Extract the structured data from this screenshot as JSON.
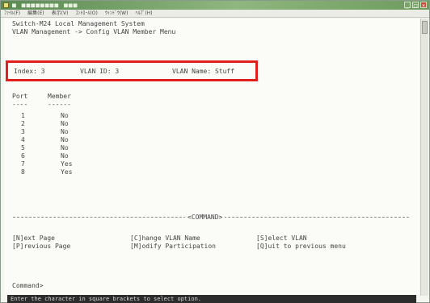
{
  "window": {
    "title": "■ ■■■■■■■■ ■■■"
  },
  "menubar": [
    "ﾌｧｲﾙ(F)",
    "編集(E)",
    "表示(V)",
    "ｺﾝﾄﾛｰﾙ(O)",
    "ｳｨﾝﾄﾞｳ(W)",
    "ﾍﾙﾌﾟ(H)"
  ],
  "terminal": {
    "system_title": "Switch-M24 Local Management System",
    "breadcrumb": "VLAN Management -> Config VLAN Member Menu",
    "index_label": "Index: 3",
    "vlan_id_label": "VLAN ID: 3",
    "vlan_name_label": "VLAN Name: Stuff",
    "columns": [
      "Port",
      "Member"
    ],
    "column_rules": [
      "----",
      "------"
    ],
    "rows": [
      {
        "port": "1",
        "member": "No"
      },
      {
        "port": "2",
        "member": "No"
      },
      {
        "port": "3",
        "member": "No"
      },
      {
        "port": "4",
        "member": "No"
      },
      {
        "port": "5",
        "member": "No"
      },
      {
        "port": "6",
        "member": "No"
      },
      {
        "port": "7",
        "member": "Yes"
      },
      {
        "port": "8",
        "member": "Yes"
      }
    ],
    "command_header": "<COMMAND>",
    "commands": {
      "next_page": "[N]ext Page",
      "previous_page": "[P]revious Page",
      "change_vlan_name": "[C]hange VLAN Name",
      "modify_participation": "[M]odify Participation",
      "select_vlan": "[S]elect VLAN",
      "quit": "[Q]uit to previous menu"
    },
    "prompt": "Command>"
  },
  "status_bar": "Enter the character in square brackets to select option.",
  "colors": {
    "highlight": "#e11f1f",
    "titlebar": "#6d9b5f",
    "status_bg": "#2c2c2c"
  }
}
